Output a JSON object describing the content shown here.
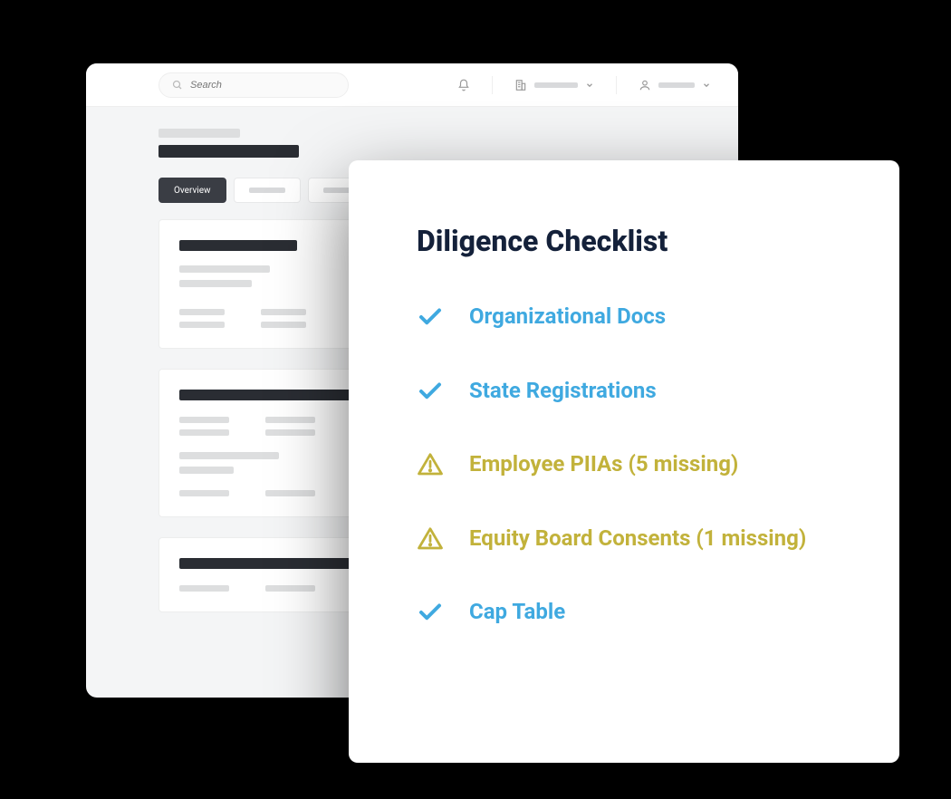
{
  "search": {
    "placeholder": "Search"
  },
  "tabs": {
    "active_label": "Overview"
  },
  "checklist": {
    "title": "Diligence Checklist",
    "items": [
      {
        "label": "Organizational Docs",
        "status": "ok"
      },
      {
        "label": "State Registrations",
        "status": "ok"
      },
      {
        "label": "Employee PIIAs (5 missing)",
        "status": "warn"
      },
      {
        "label": "Equity Board Consents (1 missing)",
        "status": "warn"
      },
      {
        "label": "Cap Table",
        "status": "ok"
      }
    ]
  }
}
